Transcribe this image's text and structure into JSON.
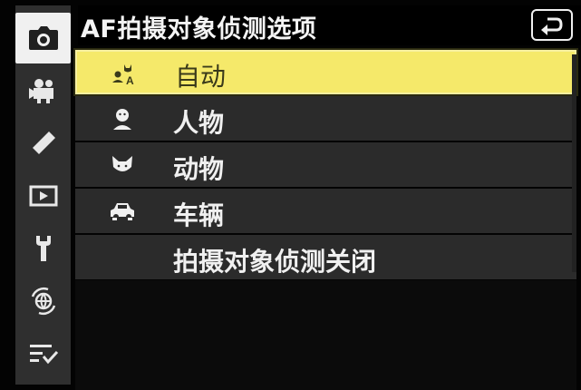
{
  "header": {
    "title": "AF拍摄对象侦测选项",
    "back_icon": "return-arrow-icon"
  },
  "sidebar": {
    "tabs": [
      {
        "icon": "camera-icon",
        "active": true
      },
      {
        "icon": "movie-camera-icon",
        "active": false
      },
      {
        "icon": "pencil-icon",
        "active": false
      },
      {
        "icon": "playback-icon",
        "active": false
      },
      {
        "icon": "wrench-icon",
        "active": false
      },
      {
        "icon": "network-globe-icon",
        "active": false
      },
      {
        "icon": "my-menu-icon",
        "active": false
      }
    ]
  },
  "menu": {
    "items": [
      {
        "label": "自动",
        "icon": "auto-subject-icon",
        "selected": true
      },
      {
        "label": "人物",
        "icon": "person-face-icon",
        "selected": false
      },
      {
        "label": "动物",
        "icon": "animal-face-icon",
        "selected": false
      },
      {
        "label": "车辆",
        "icon": "vehicle-icon",
        "selected": false
      },
      {
        "label": "拍摄对象侦测关闭",
        "icon": "",
        "selected": false
      }
    ]
  },
  "colors": {
    "highlight": "#f5e96a",
    "row_bg": "#2b2b2b",
    "sidebar_bg": "#2f2f2f",
    "active_tab": "#f0f0f0"
  }
}
